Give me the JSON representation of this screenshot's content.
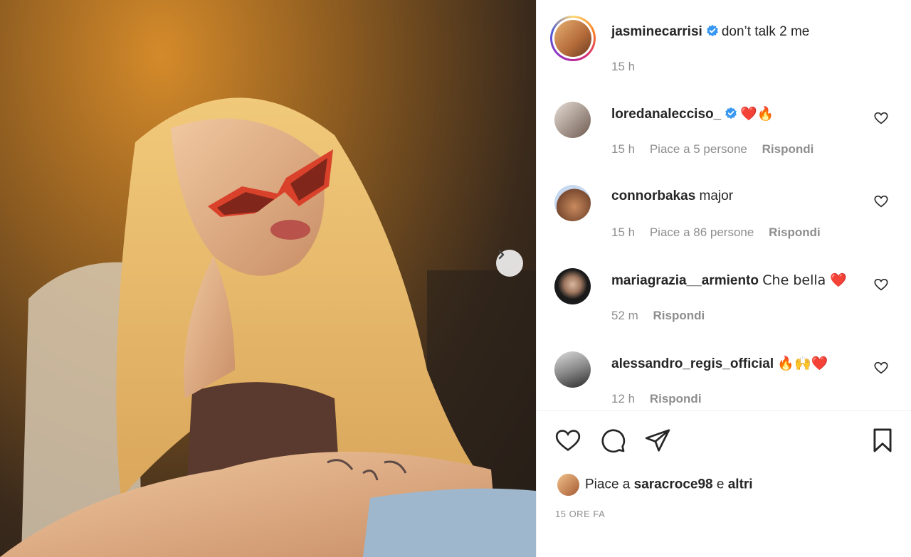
{
  "post": {
    "author": "jasminecarrisi",
    "caption": "don’t talk 2 me",
    "time": "15 h"
  },
  "comments": [
    {
      "user": "loredanalecciso_",
      "verified": true,
      "text": "❤️🔥",
      "time": "15 h",
      "likes": "Piace a 5 persone",
      "reply": "Rispondi"
    },
    {
      "user": "connorbakas",
      "verified": false,
      "text": "major",
      "time": "15 h",
      "likes": "Piace a 86 persone",
      "reply": "Rispondi"
    },
    {
      "user": "mariagrazia__armiento",
      "verified": false,
      "text": "Che bella ❤️",
      "time": "52 m",
      "likes": "",
      "reply": "Rispondi"
    },
    {
      "user": "alessandro_regis_official",
      "verified": false,
      "text": "🔥🙌❤️",
      "time": "12 h",
      "likes": "",
      "reply": "Rispondi"
    }
  ],
  "likes_summary": {
    "prefix": "Piace a",
    "user": "saracroce98",
    "connector": "e",
    "suffix": "altri"
  },
  "posted_ago": "15 ORE FA",
  "colors": {
    "verified": "#3897f0",
    "muted": "#8e8e8e",
    "heart": "#e0243b"
  }
}
